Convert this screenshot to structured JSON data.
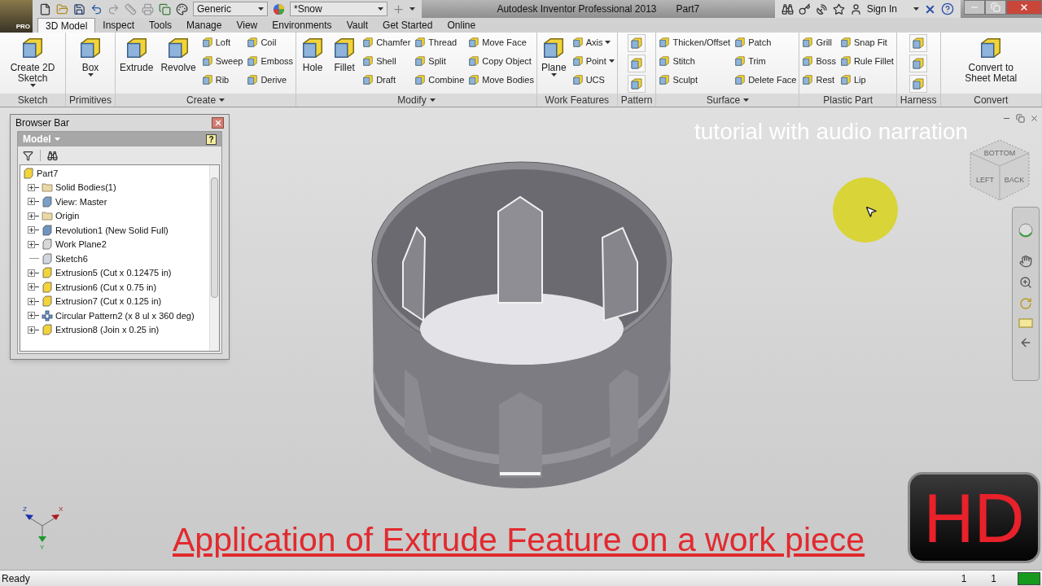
{
  "title_bar": {
    "logo_badge": "PRO",
    "material": "Generic",
    "appearance": "*Snow",
    "title": "Autodesk Inventor Professional 2013",
    "document": "Part7",
    "sign_in": "Sign In"
  },
  "tabs": [
    {
      "label": "3D Model",
      "selected": true
    },
    {
      "label": "Inspect",
      "selected": false
    },
    {
      "label": "Tools",
      "selected": false
    },
    {
      "label": "Manage",
      "selected": false
    },
    {
      "label": "View",
      "selected": false
    },
    {
      "label": "Environments",
      "selected": false
    },
    {
      "label": "Vault",
      "selected": false
    },
    {
      "label": "Get Started",
      "selected": false
    },
    {
      "label": "Online",
      "selected": false
    }
  ],
  "ribbon_panels": [
    {
      "label": "Sketch",
      "menu": false,
      "columns": [
        [
          {
            "kind": "large",
            "label": "Create 2D Sketch",
            "dropdown": true
          }
        ]
      ]
    },
    {
      "label": "Primitives",
      "menu": false,
      "columns": [
        [
          {
            "kind": "large",
            "label": "Box",
            "dropdown": true
          }
        ]
      ]
    },
    {
      "label": "Create",
      "menu": true,
      "columns": [
        [
          {
            "kind": "large",
            "label": "Extrude",
            "dropdown": false
          }
        ],
        [
          {
            "kind": "large",
            "label": "Revolve",
            "dropdown": false
          }
        ],
        [
          {
            "kind": "small",
            "label": "Loft",
            "dropdown": false
          },
          {
            "kind": "small",
            "label": "Sweep",
            "dropdown": false
          },
          {
            "kind": "small",
            "label": "Rib",
            "dropdown": false
          }
        ],
        [
          {
            "kind": "small",
            "label": "Coil",
            "dropdown": false
          },
          {
            "kind": "small",
            "label": "Emboss",
            "dropdown": false
          },
          {
            "kind": "small",
            "label": "Derive",
            "dropdown": false
          }
        ]
      ]
    },
    {
      "label": "Modify",
      "menu": true,
      "columns": [
        [
          {
            "kind": "large",
            "label": "Hole",
            "dropdown": false
          }
        ],
        [
          {
            "kind": "large",
            "label": "Fillet",
            "dropdown": false
          }
        ],
        [
          {
            "kind": "small",
            "label": "Chamfer",
            "dropdown": false
          },
          {
            "kind": "small",
            "label": "Shell",
            "dropdown": false
          },
          {
            "kind": "small",
            "label": "Draft",
            "dropdown": false
          }
        ],
        [
          {
            "kind": "small",
            "label": "Thread",
            "dropdown": false
          },
          {
            "kind": "small",
            "label": "Split",
            "dropdown": false
          },
          {
            "kind": "small",
            "label": "Combine",
            "dropdown": false
          }
        ],
        [
          {
            "kind": "small",
            "label": "Move Face",
            "dropdown": false
          },
          {
            "kind": "small",
            "label": "Copy Object",
            "dropdown": false
          },
          {
            "kind": "small",
            "label": "Move Bodies",
            "dropdown": false
          }
        ]
      ]
    },
    {
      "label": "Work Features",
      "menu": false,
      "columns": [
        [
          {
            "kind": "large",
            "label": "Plane",
            "dropdown": true
          }
        ],
        [
          {
            "kind": "small",
            "label": "Axis",
            "dropdown": true
          },
          {
            "kind": "small",
            "label": "Point",
            "dropdown": true
          },
          {
            "kind": "small",
            "label": "UCS",
            "dropdown": false
          }
        ]
      ]
    },
    {
      "label": "Pattern",
      "menu": false,
      "columns": [
        [
          {
            "kind": "icon"
          },
          {
            "kind": "icon"
          },
          {
            "kind": "icon"
          }
        ]
      ]
    },
    {
      "label": "Surface",
      "menu": true,
      "columns": [
        [
          {
            "kind": "small",
            "label": "Thicken/Offset",
            "dropdown": false
          },
          {
            "kind": "small",
            "label": "Stitch",
            "dropdown": false
          },
          {
            "kind": "small",
            "label": "Sculpt",
            "dropdown": false
          }
        ],
        [
          {
            "kind": "small",
            "label": "Patch",
            "dropdown": false
          },
          {
            "kind": "small",
            "label": "Trim",
            "dropdown": false
          },
          {
            "kind": "small",
            "label": "Delete Face",
            "dropdown": false
          }
        ]
      ]
    },
    {
      "label": "Plastic Part",
      "menu": false,
      "columns": [
        [
          {
            "kind": "small",
            "label": "Grill",
            "dropdown": false
          },
          {
            "kind": "small",
            "label": "Boss",
            "dropdown": false
          },
          {
            "kind": "small",
            "label": "Rest",
            "dropdown": false
          }
        ],
        [
          {
            "kind": "small",
            "label": "Snap Fit",
            "dropdown": false
          },
          {
            "kind": "small",
            "label": "Rule Fillet",
            "dropdown": false
          },
          {
            "kind": "small",
            "label": "Lip",
            "dropdown": false
          }
        ]
      ]
    },
    {
      "label": "Harness",
      "menu": false,
      "columns": [
        [
          {
            "kind": "icon"
          },
          {
            "kind": "icon"
          },
          {
            "kind": "icon"
          }
        ]
      ]
    },
    {
      "label": "Convert",
      "menu": false,
      "columns": [
        [
          {
            "kind": "large",
            "label": "Convert to Sheet Metal",
            "dropdown": false
          }
        ]
      ]
    }
  ],
  "browser": {
    "title": "Browser Bar",
    "view": "Model",
    "help": "?",
    "tree": [
      {
        "label": "Part7",
        "kind": "part",
        "children": [
          {
            "label": "Solid Bodies(1)",
            "kind": "folder",
            "expandable": true
          },
          {
            "label": "View: Master",
            "kind": "view",
            "expandable": true
          },
          {
            "label": "Origin",
            "kind": "folder",
            "expandable": true
          },
          {
            "label": "Revolution1 (New Solid Full)",
            "kind": "revolution",
            "expandable": true
          },
          {
            "label": "Work Plane2",
            "kind": "plane",
            "expandable": true
          },
          {
            "label": "Sketch6",
            "kind": "sketch",
            "expandable": false
          },
          {
            "label": "Extrusion5 (Cut x 0.12475 in)",
            "kind": "extrusion",
            "expandable": true
          },
          {
            "label": "Extrusion6 (Cut x 0.75 in)",
            "kind": "extrusion",
            "expandable": true
          },
          {
            "label": "Extrusion7 (Cut x 0.125 in)",
            "kind": "extrusion",
            "expandable": true
          },
          {
            "label": "Circular Pattern2 (x 8 ul x 360 deg)",
            "kind": "pattern",
            "expandable": true
          },
          {
            "label": "Extrusion8 (Join x 0.25 in)",
            "kind": "extrusion",
            "expandable": true
          }
        ]
      }
    ]
  },
  "viewport": {
    "narration": "tutorial with audio narration",
    "caption": "Application of Extrude Feature on a work piece",
    "hd_badge": "HD",
    "view_cube": [
      "BOTTOM",
      "LEFT",
      "BACK"
    ],
    "axes": [
      "Z",
      "X",
      "Y"
    ]
  },
  "status_bar": {
    "message": "Ready",
    "counter_1": "1",
    "counter_2": "1"
  }
}
